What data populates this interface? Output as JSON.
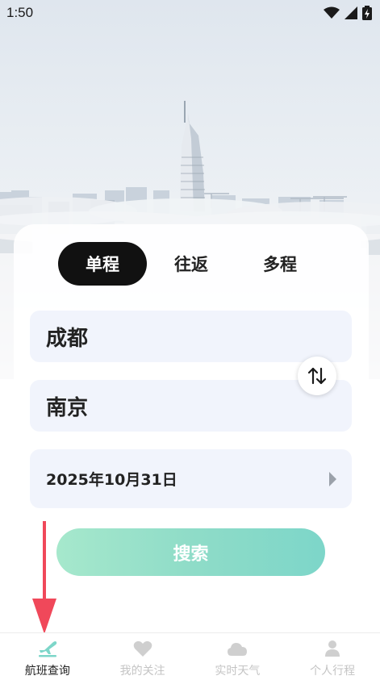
{
  "status_bar": {
    "time": "1:50"
  },
  "trip_tabs": [
    {
      "label": "单程",
      "active": true
    },
    {
      "label": "往返",
      "active": false
    },
    {
      "label": "多程",
      "active": false
    }
  ],
  "form": {
    "from_city": "成都",
    "to_city": "南京",
    "date": "2025年10月31日",
    "search_label": "搜索"
  },
  "bottom_nav": [
    {
      "label": "航班查询",
      "icon": "plane-icon",
      "active": true
    },
    {
      "label": "我的关注",
      "icon": "heart-icon",
      "active": false
    },
    {
      "label": "实时天气",
      "icon": "cloud-icon",
      "active": false
    },
    {
      "label": "个人行程",
      "icon": "person-icon",
      "active": false
    }
  ],
  "colors": {
    "accent_start": "#a6e8cc",
    "accent_end": "#7dd6c9",
    "active_tab": "#111111",
    "field_bg": "#f1f4fc",
    "annotation_arrow": "#f0485a"
  }
}
